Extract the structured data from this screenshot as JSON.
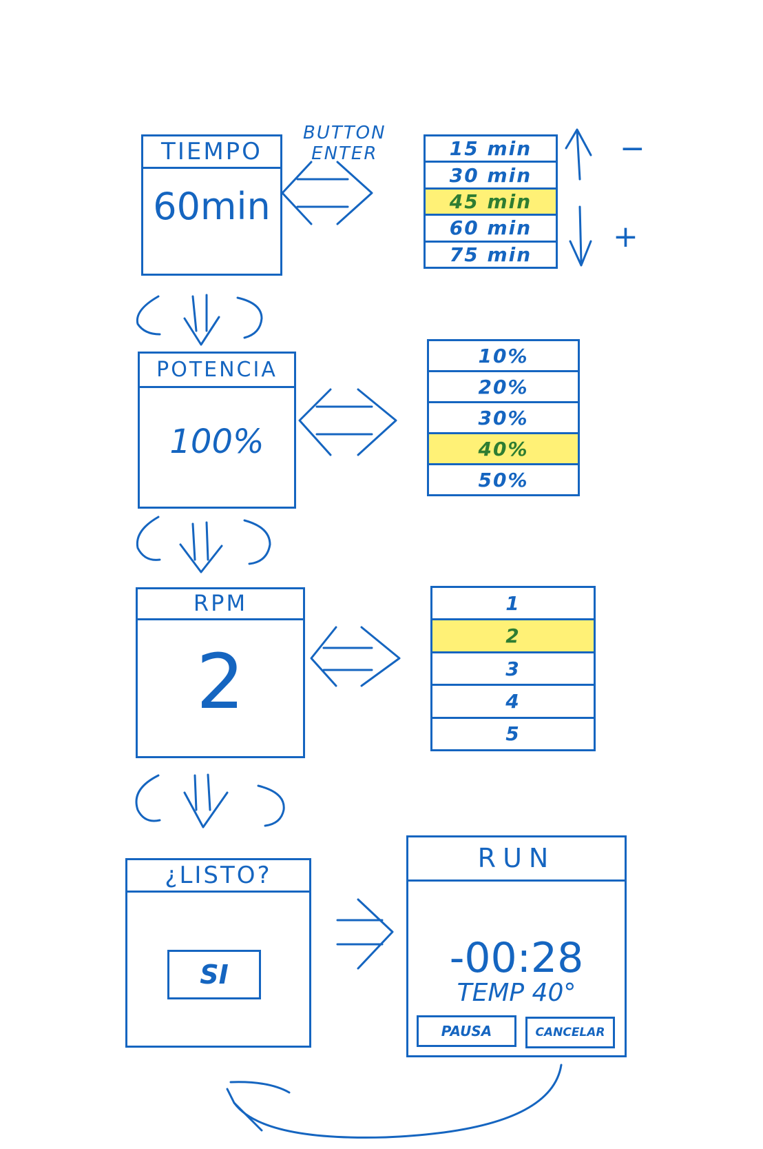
{
  "annotations": {
    "button_label_line1": "BUTTON",
    "button_label_line2": "ENTER",
    "minus_sign": "−",
    "plus_sign": "+"
  },
  "screens": {
    "tiempo": {
      "title": "TIEMPO",
      "value": "60min"
    },
    "potencia": {
      "title": "POTENCIA",
      "value": "100%"
    },
    "rpm": {
      "title": "RPM",
      "value": "2"
    },
    "listo": {
      "title": "¿LISTO?",
      "button": "SI"
    },
    "run": {
      "title": "RUN",
      "timer": "-00:28",
      "temp": "TEMP 40°",
      "pause_button": "PAUSA",
      "cancel_button": "CANCELAR"
    }
  },
  "lists": {
    "tiempo_options": [
      "15 min",
      "30 min",
      "45 min",
      "60 min",
      "75 min"
    ],
    "tiempo_selected": 2,
    "potencia_options": [
      "10%",
      "20%",
      "30%",
      "40%",
      "50%"
    ],
    "potencia_selected": 3,
    "rpm_options": [
      "1",
      "2",
      "3",
      "4",
      "5"
    ],
    "rpm_selected": 1
  },
  "colors": {
    "ink": "#1565c0",
    "highlight": "#fff176",
    "highlight_text": "#2e7d32"
  }
}
